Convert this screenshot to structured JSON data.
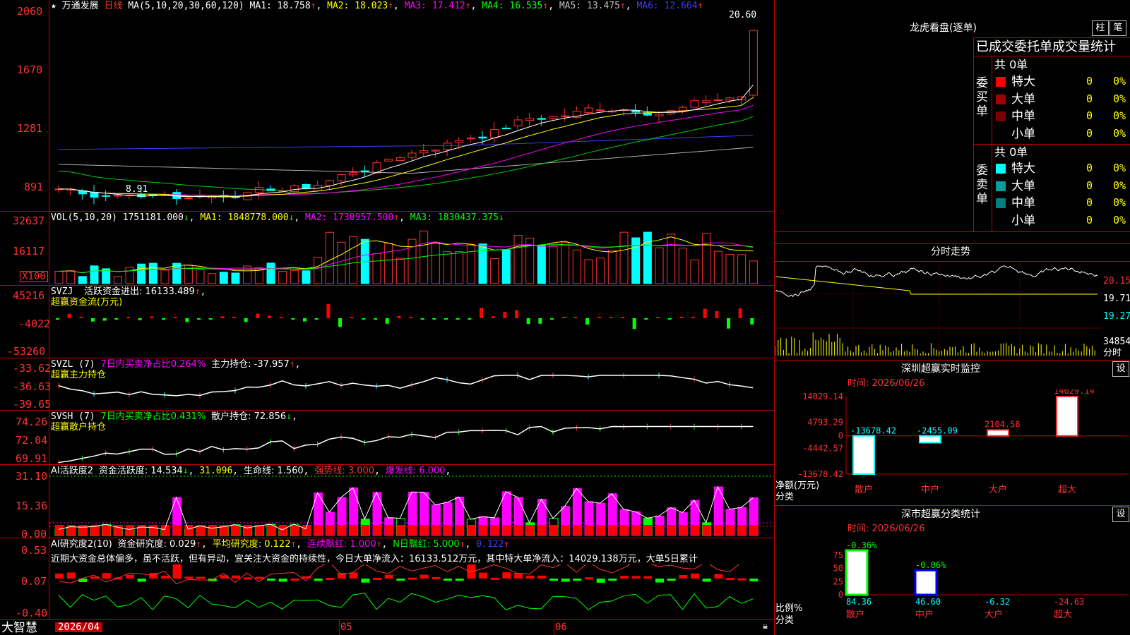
{
  "stock": {
    "name": "万通发展",
    "period": "日线",
    "star": "★"
  },
  "main": {
    "ma_label": "MA(5,10,20,30,60,120)",
    "ma1": "MA1: 18.758",
    "ma2": "MA2: 18.023",
    "ma3": "MA3: 17.412",
    "ma4": "MA4: 16.535",
    "ma5": "MA5: 13.475",
    "ma6": "MA6: 12.664",
    "y_ticks": [
      "2060",
      "1670",
      "1281",
      "891"
    ],
    "high_label": "20.60",
    "low_label": "8.91"
  },
  "vol": {
    "label": "VOL(5,10,20)",
    "v": "1751181.000",
    "ma1": "MA1: 1848778.000",
    "ma2": "MA2: 1730957.500",
    "ma3": "MA3: 1830437.375",
    "y_ticks": [
      "32637",
      "16117"
    ],
    "unit": "X100"
  },
  "svzj": {
    "label": "SVZJ",
    "title": "活跃资金进出: 16133.489",
    "sub": "超赢资金流(万元)",
    "y_ticks": [
      "45216",
      "-4022",
      "-53260"
    ]
  },
  "svzl": {
    "label": "SVZL (7)",
    "ratio": "7日内买卖净占比0.264%",
    "hold": "主力持仓: -37.957",
    "sub": "超赢主力持仓",
    "y_ticks": [
      "-33.62",
      "-36.63",
      "-39.65"
    ]
  },
  "svsh": {
    "label": "SVSH (7)",
    "ratio": "7日内买卖净占比0.431%",
    "hold": "散户持仓: 72.856",
    "sub": "超赢散户持仓",
    "y_ticks": [
      "74.26",
      "72.04",
      "69.91"
    ]
  },
  "ai1": {
    "label": "AI活跃度2",
    "act": "资金活跃度: 14.534",
    "v2": "31.096",
    "life": "生命线: 1.560",
    "strong": "强势线: 3.000",
    "burst": "爆发线: 6.000",
    "y_ticks": [
      "31.10",
      "15.36",
      "0.00"
    ]
  },
  "ai2": {
    "label": "AI研究度2(10)",
    "res": "资金研究度: 0.029",
    "avg": "平均研究度: 0.122",
    "red": "连续飘红: 1.000",
    "nred": "N日飘红: 5.000",
    "v5": "0.122",
    "comment": "近期大资金总体偏多，虽不活跃，但有异动，宜关注大资金的持续性，今日大单净流入：16133.512万元，其中特大单净流入：14029.138万元，大单5日累计",
    "y_ticks": [
      "0.53",
      "0.07",
      "-0.40"
    ]
  },
  "bottom": {
    "app": "大智慧",
    "date": "2026/04",
    "m5": "05",
    "m6": "06"
  },
  "dragon": {
    "title": "龙虎看盘(逐单)",
    "btn1": "柱",
    "btn2": "笔",
    "tab": "已成交委托单成交量统计",
    "buy": {
      "label": "委买单",
      "total": "共 0单",
      "rows": [
        {
          "name": "特大",
          "v": "0",
          "p": "0%",
          "c": "#ff0000"
        },
        {
          "name": "大单",
          "v": "0",
          "p": "0%",
          "c": "#a00000"
        },
        {
          "name": "中单",
          "v": "0",
          "p": "0%",
          "c": "#780000"
        },
        {
          "name": "小单",
          "v": "0",
          "p": "0%",
          "c": "#000000"
        }
      ]
    },
    "sell": {
      "label": "委卖单",
      "total": "共 0单",
      "rows": [
        {
          "name": "特大",
          "v": "0",
          "p": "0%",
          "c": "#00ffff"
        },
        {
          "name": "大单",
          "v": "0",
          "p": "0%",
          "c": "#00a0a0"
        },
        {
          "name": "中单",
          "v": "0",
          "p": "0%",
          "c": "#008080"
        },
        {
          "name": "小单",
          "v": "0",
          "p": "0%",
          "c": "#000000"
        }
      ]
    }
  },
  "intraday": {
    "title": "分时走势",
    "p1": "20.15",
    "p2": "19.71",
    "p3": "19.27",
    "vol": "34854",
    "unit": "分时"
  },
  "monitor": {
    "title": "深圳超赢实时监控",
    "btn": "设",
    "time": "时间: 2026/06/26",
    "y_ticks": [
      "14029.14",
      "4793.29",
      "0",
      "-4442.57",
      "-13678.42"
    ],
    "ylabel": "净额(万元)",
    "xlabel": "分类",
    "cats": [
      "散户",
      "中户",
      "大户",
      "超大"
    ],
    "values": [
      -13678.42,
      -2455.09,
      2104.58,
      14029.14
    ],
    "labels": [
      "-13678.42",
      "-2455.09",
      "2104.58",
      "14029.14"
    ]
  },
  "stats": {
    "title": "深市超赢分类统计",
    "btn": "设",
    "time": "时间: 2026/06/26",
    "y_ticks": [
      "75",
      "50",
      "25",
      "0"
    ],
    "ylabel": "比例%",
    "xlabel": "分类",
    "cats": [
      "散户",
      "中户",
      "大户",
      "超大"
    ],
    "top_labels": [
      "-0.36%",
      "-0.06%"
    ],
    "bottom_labels": [
      "84.36",
      "46.60",
      "-6.32",
      "-24.63"
    ],
    "values": [
      84.36,
      46.6,
      -6.32,
      -24.63
    ]
  }
}
